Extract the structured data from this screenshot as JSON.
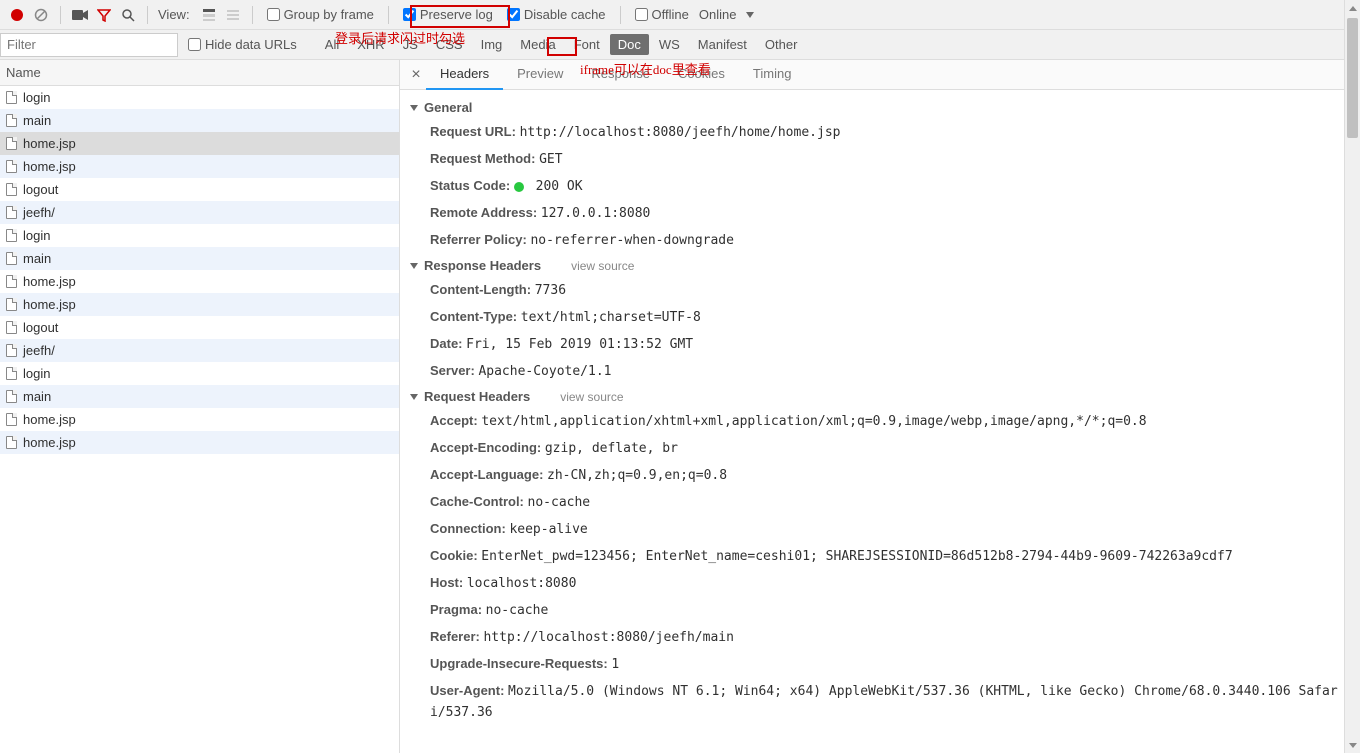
{
  "toolbar": {
    "view_label": "View:",
    "group_by_frame": "Group by frame",
    "preserve_log": "Preserve log",
    "disable_cache": "Disable cache",
    "offline": "Offline",
    "online": "Online"
  },
  "filterbar": {
    "placeholder": "Filter",
    "hide_data_urls": "Hide data URLs",
    "types": [
      "All",
      "XHR",
      "JS",
      "CSS",
      "Img",
      "Media",
      "Font",
      "Doc",
      "WS",
      "Manifest",
      "Other"
    ],
    "active_type_index": 7
  },
  "annotations": {
    "note1": "登录后请求闪过时勾选",
    "note2": "iframe可以在doc里查看"
  },
  "name_header": "Name",
  "requests": [
    "login",
    "main",
    "home.jsp",
    "home.jsp",
    "logout",
    "jeefh/",
    "login",
    "main",
    "home.jsp",
    "home.jsp",
    "logout",
    "jeefh/",
    "login",
    "main",
    "home.jsp",
    "home.jsp"
  ],
  "selected_request_index": 2,
  "tabs": {
    "items": [
      "Headers",
      "Preview",
      "Response",
      "Cookies",
      "Timing"
    ],
    "active_index": 0
  },
  "sections": {
    "general": {
      "title": "General",
      "rows": [
        {
          "k": "Request URL:",
          "v": " http://localhost:8080/jeefh/home/home.jsp"
        },
        {
          "k": "Request Method:",
          "v": " GET"
        },
        {
          "k": "Status Code:",
          "v": " 200 OK",
          "status": true
        },
        {
          "k": "Remote Address:",
          "v": " 127.0.0.1:8080"
        },
        {
          "k": "Referrer Policy:",
          "v": " no-referrer-when-downgrade"
        }
      ]
    },
    "response_headers": {
      "title": "Response Headers",
      "view_source": "view source",
      "rows": [
        {
          "k": "Content-Length:",
          "v": " 7736"
        },
        {
          "k": "Content-Type:",
          "v": " text/html;charset=UTF-8"
        },
        {
          "k": "Date:",
          "v": " Fri, 15 Feb 2019 01:13:52 GMT"
        },
        {
          "k": "Server:",
          "v": " Apache-Coyote/1.1"
        }
      ]
    },
    "request_headers": {
      "title": "Request Headers",
      "view_source": "view source",
      "rows": [
        {
          "k": "Accept:",
          "v": " text/html,application/xhtml+xml,application/xml;q=0.9,image/webp,image/apng,*/*;q=0.8"
        },
        {
          "k": "Accept-Encoding:",
          "v": " gzip, deflate, br"
        },
        {
          "k": "Accept-Language:",
          "v": " zh-CN,zh;q=0.9,en;q=0.8"
        },
        {
          "k": "Cache-Control:",
          "v": " no-cache"
        },
        {
          "k": "Connection:",
          "v": " keep-alive"
        },
        {
          "k": "Cookie:",
          "v": " EnterNet_pwd=123456; EnterNet_name=ceshi01; SHAREJSESSIONID=86d512b8-2794-44b9-9609-742263a9cdf7"
        },
        {
          "k": "Host:",
          "v": " localhost:8080"
        },
        {
          "k": "Pragma:",
          "v": " no-cache"
        },
        {
          "k": "Referer:",
          "v": " http://localhost:8080/jeefh/main"
        },
        {
          "k": "Upgrade-Insecure-Requests:",
          "v": " 1"
        },
        {
          "k": "User-Agent:",
          "v": " Mozilla/5.0 (Windows NT 6.1; Win64; x64) AppleWebKit/537.36 (KHTML, like Gecko) Chrome/68.0.3440.106 Safari/537.36"
        }
      ]
    }
  }
}
